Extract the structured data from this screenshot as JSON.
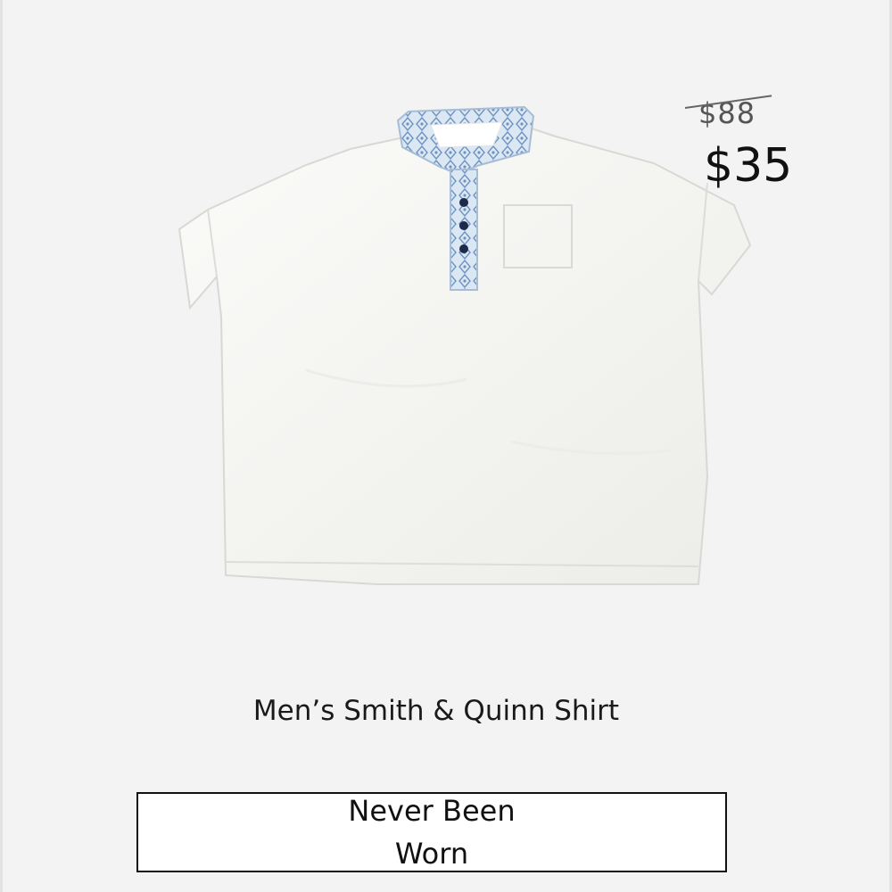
{
  "pricing": {
    "original_price": "$88",
    "sale_price": "$35"
  },
  "product": {
    "title": "Men’s Smith & Quinn Shirt",
    "condition": "Never Been Worn",
    "image_icon": "polo-shirt-photo"
  },
  "colors": {
    "background": "#f3f3f3",
    "shirt": "#f7f7f5",
    "collar": "#b8cfe6",
    "button": "#1d2a4a"
  }
}
